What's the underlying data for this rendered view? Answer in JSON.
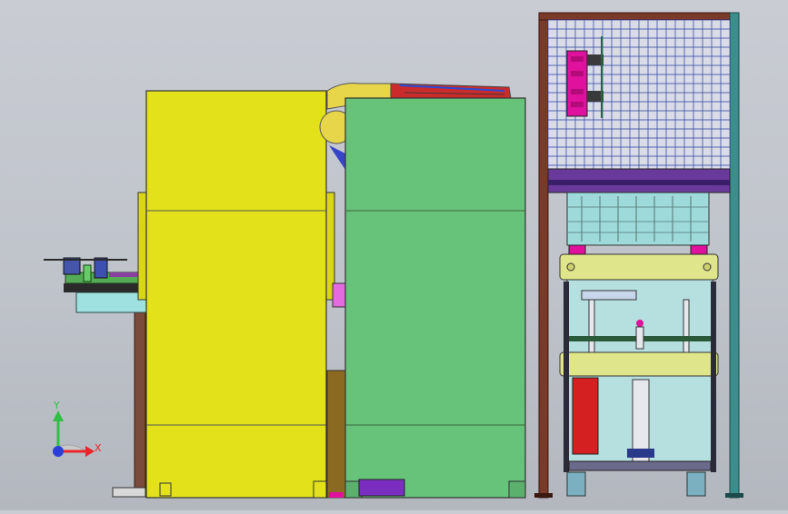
{
  "app": {
    "view": "3d-cad-assembly-front-view"
  },
  "triad": {
    "x_label": "X",
    "y_label": "Y",
    "x_color": "#e8262a",
    "y_color": "#2fbf45",
    "z_color": "#2b3fd6"
  },
  "colors": {
    "background": "#c4c7ce",
    "yellow_cabinet": "#e3e21a",
    "green_cabinet": "#67c27a",
    "frame_brown": "#7a3a2a",
    "mesh_blue": "#2c3fa0",
    "magenta_parts": "#e0119c",
    "press_plate": "#dfe58a",
    "teal_frame": "#3a8f8a",
    "red_panel": "#d42020",
    "robot_yellow": "#e7d54a"
  }
}
